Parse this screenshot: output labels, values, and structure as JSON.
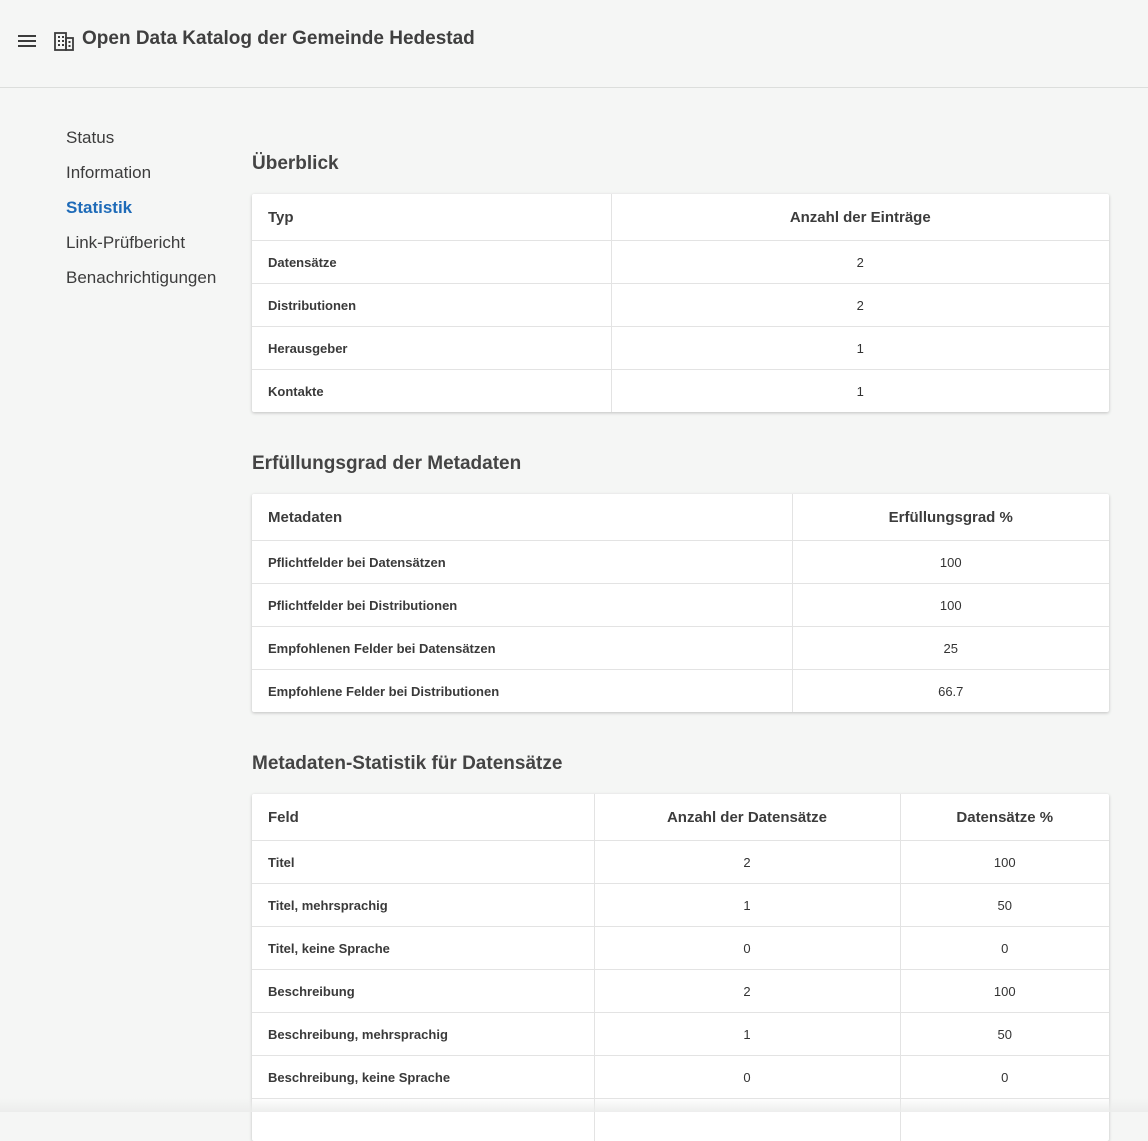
{
  "header": {
    "title": "Open Data Katalog der Gemeinde Hedestad",
    "menu_icon": "hamburger-menu-icon",
    "brand_icon": "building-icon"
  },
  "sidebar": {
    "items": [
      {
        "label": "Status",
        "active": false
      },
      {
        "label": "Information",
        "active": false
      },
      {
        "label": "Statistik",
        "active": true
      },
      {
        "label": "Link-Prüfbericht",
        "active": false
      },
      {
        "label": "Benachrichtigungen",
        "active": false
      }
    ],
    "active_color": "#1e6bb8"
  },
  "overview": {
    "title": "Überblick",
    "headers": [
      "Typ",
      "Anzahl der Einträge"
    ],
    "rows": [
      [
        "Datensätze",
        "2"
      ],
      [
        "Distributionen",
        "2"
      ],
      [
        "Herausgeber",
        "1"
      ],
      [
        "Kontakte",
        "1"
      ]
    ]
  },
  "completeness": {
    "title": "Erfüllungsgrad der Metadaten",
    "headers": [
      "Metadaten",
      "Erfüllungsgrad %"
    ],
    "rows": [
      [
        "Pflichtfelder bei Datensätzen",
        "100"
      ],
      [
        "Pflichtfelder bei Distributionen",
        "100"
      ],
      [
        "Empfohlenen Felder bei Datensätzen",
        "25"
      ],
      [
        "Empfohlene Felder bei Distributionen",
        "66.7"
      ]
    ]
  },
  "dataset_stats": {
    "title": "Metadaten-Statistik für Datensätze",
    "headers": [
      "Feld",
      "Anzahl der Datensätze",
      "Datensätze %"
    ],
    "rows": [
      [
        "Titel",
        "2",
        "100"
      ],
      [
        "Titel, mehrsprachig",
        "1",
        "50"
      ],
      [
        "Titel, keine Sprache",
        "0",
        "0"
      ],
      [
        "Beschreibung",
        "2",
        "100"
      ],
      [
        "Beschreibung, mehrsprachig",
        "1",
        "50"
      ],
      [
        "Beschreibung, keine Sprache",
        "0",
        "0"
      ],
      [
        "",
        "",
        ""
      ]
    ]
  }
}
